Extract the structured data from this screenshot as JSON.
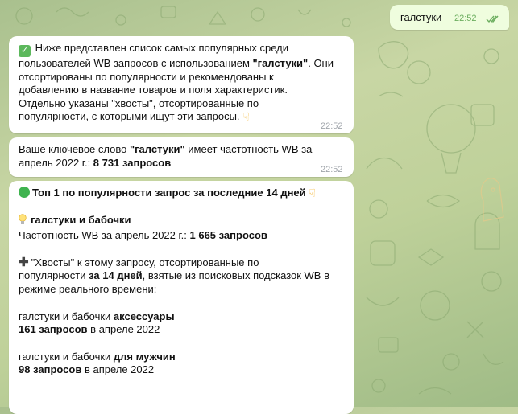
{
  "outgoing": {
    "text": "галстуки",
    "time": "22:52"
  },
  "message1": {
    "check": "✅",
    "lines": [
      "Ниже представлен список самых популярных среди",
      "пользователей WB запросов с использованием ",
      "\"галстуки\"",
      ". Они",
      "отсортированы по популярности и рекомендованы к",
      "добавлению в название товаров и поля характеристик.",
      "Отдельно указаны \"хвосты\", отсортированные по",
      "популярности, с которыми ищут эти запросы. "
    ],
    "hand": "👇",
    "time": "22:52"
  },
  "message2": {
    "prefix": "Ваше ключевое слово ",
    "keyword": "\"галстуки\"",
    "middle": " имеет частотность WB за",
    "line2_prefix": "апрель 2022 г.: ",
    "count": "8 731 запросов",
    "time": "22:52"
  },
  "message3": {
    "heading": "Топ 1 по популярности запрос за последние 14 дней",
    "hand": "👇",
    "query": "галстуки и бабочки",
    "freq_prefix": "Частотность WB за апрель 2022 г.: ",
    "freq_value": "1 665 запросов",
    "tails_line1": "\"Хвосты\" к этому запросу, отсортированные по",
    "tails_line2_prefix": "популярности ",
    "tails_line2_bold": "за 14 дней",
    "tails_line2_suffix": ", взятые из поисковых подсказок WB в",
    "tails_line3": "режиме реального времени:",
    "items": [
      {
        "base": "галстуки и бабочки ",
        "tail": "аксессуары",
        "count": "161 запросов",
        "suffix": " в апреле 2022"
      },
      {
        "base": "галстуки и бабочки ",
        "tail": "для мужчин",
        "count": "98 запросов",
        "suffix": " в апреле 2022"
      }
    ]
  },
  "colors": {
    "outgoing_bg": "#effdde",
    "incoming_bg": "#ffffff",
    "check_read": "#6cae5f",
    "time_gray": "#a0a5ab"
  }
}
